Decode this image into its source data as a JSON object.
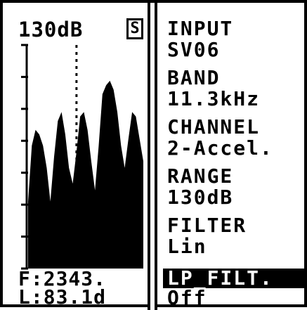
{
  "analyzer": {
    "range_readout": "130dB",
    "mode_badge": "S",
    "frequency_readout": "F:2343.",
    "level_readout": "L:83.1d",
    "cursor_style": "dotted"
  },
  "params": [
    {
      "label": "INPUT",
      "value": "SV06"
    },
    {
      "label": "BAND",
      "value": "11.3kHz"
    },
    {
      "label": "CHANNEL",
      "value": "2-Accel."
    },
    {
      "label": "RANGE",
      "value": "130dB"
    },
    {
      "label": "FILTER",
      "value": "Lin"
    }
  ],
  "lp_filter": {
    "label": "LP_FILT.",
    "value": "Off",
    "selected": true
  },
  "chart_data": {
    "type": "area",
    "title": "",
    "xlabel": "",
    "ylabel": "",
    "y_tick_count": 8,
    "cursor_x_fraction": 0.42,
    "y": [
      0.3,
      0.55,
      0.62,
      0.6,
      0.55,
      0.45,
      0.3,
      0.5,
      0.66,
      0.7,
      0.6,
      0.45,
      0.38,
      0.52,
      0.68,
      0.7,
      0.62,
      0.48,
      0.35,
      0.55,
      0.78,
      0.82,
      0.84,
      0.8,
      0.7,
      0.55,
      0.45,
      0.58,
      0.7,
      0.68,
      0.58,
      0.48
    ]
  },
  "colors": {
    "foreground": "#000000",
    "background": "#ffffff"
  }
}
